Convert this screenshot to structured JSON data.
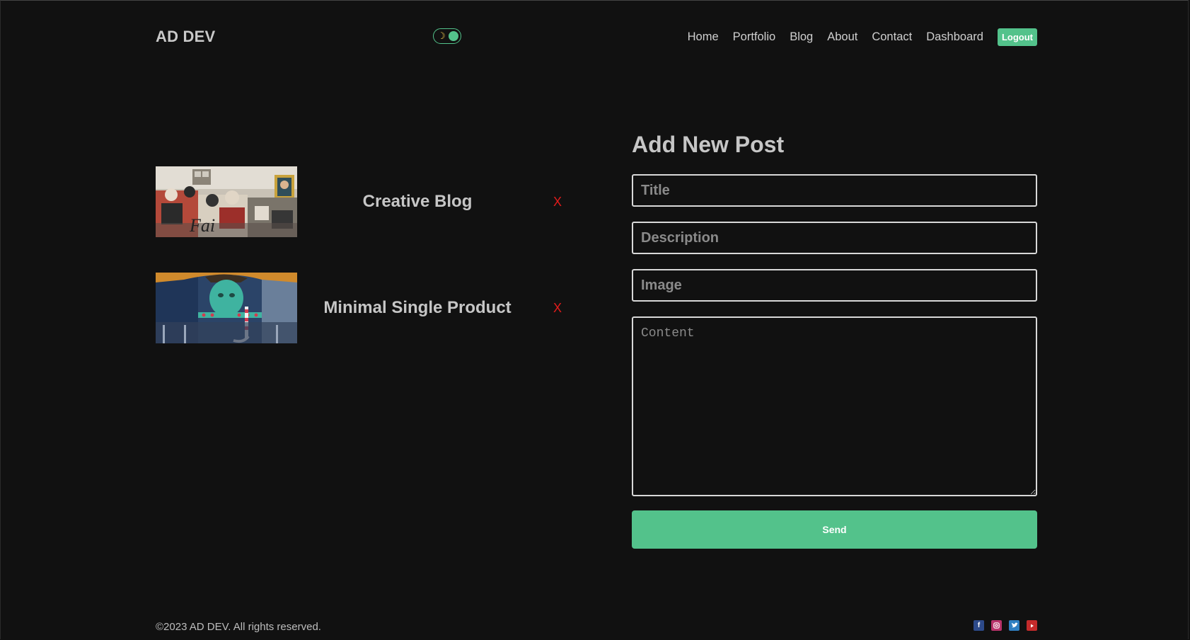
{
  "header": {
    "logo": "AD DEV",
    "toggle_icon": "moon-icon",
    "nav": [
      "Home",
      "Portfolio",
      "Blog",
      "About",
      "Contact",
      "Dashboard"
    ],
    "logout_label": "Logout"
  },
  "posts": [
    {
      "title": "Creative Blog",
      "delete_label": "X"
    },
    {
      "title": "Minimal Single Product",
      "delete_label": "X"
    }
  ],
  "form": {
    "heading": "Add New Post",
    "title_placeholder": "Title",
    "description_placeholder": "Description",
    "image_placeholder": "Image",
    "content_placeholder": "Content",
    "send_label": "Send"
  },
  "footer": {
    "copyright": "©2023 AD DEV. All rights reserved.",
    "socials": [
      "facebook-icon",
      "instagram-icon",
      "twitter-icon",
      "youtube-icon"
    ]
  },
  "colors": {
    "background": "#111111",
    "accent": "#53c28b",
    "delete": "#e11b1b"
  }
}
